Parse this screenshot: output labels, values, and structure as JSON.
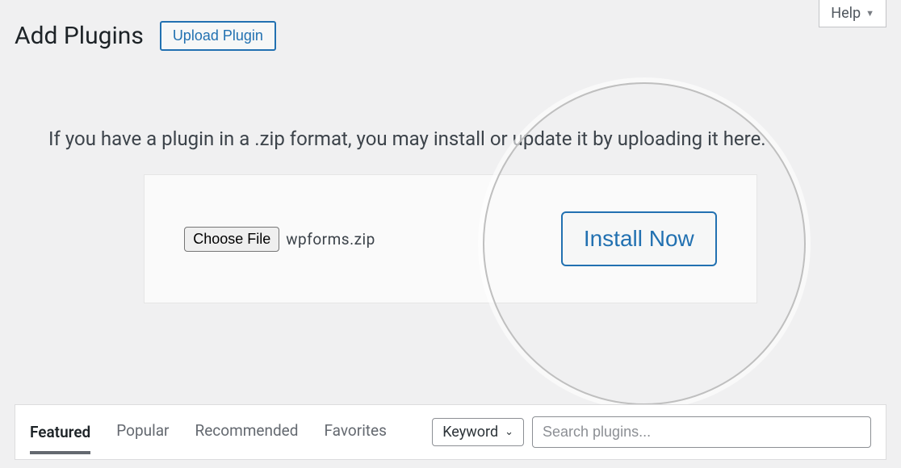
{
  "help": {
    "label": "Help"
  },
  "header": {
    "title": "Add Plugins",
    "upload_button": "Upload Plugin"
  },
  "description": "If you have a plugin in a .zip format, you may install or update it by uploading it here.",
  "upload": {
    "choose_file": "Choose File",
    "file_name": "wpforms.zip",
    "install_now": "Install Now"
  },
  "tabs": {
    "featured": "Featured",
    "popular": "Popular",
    "recommended": "Recommended",
    "favorites": "Favorites"
  },
  "search": {
    "select_label": "Keyword",
    "placeholder": "Search plugins..."
  }
}
